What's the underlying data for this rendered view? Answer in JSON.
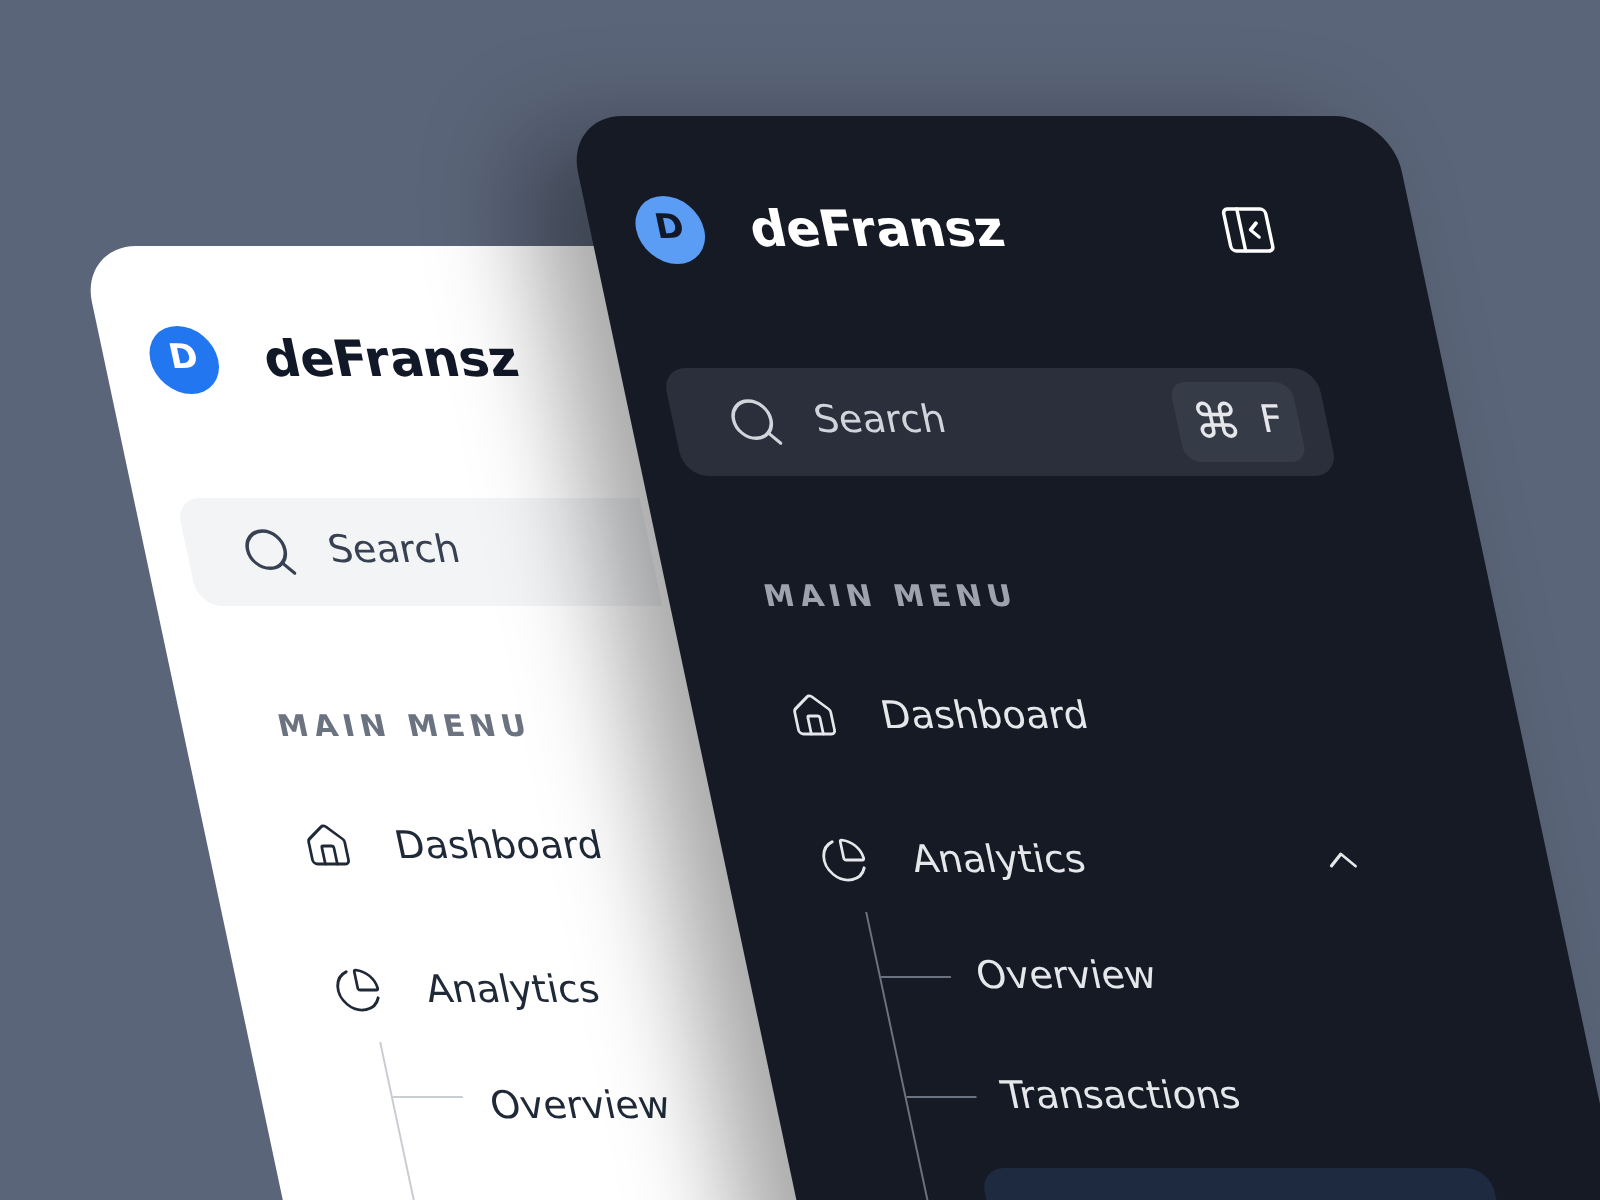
{
  "panels": [
    {
      "kind": "light",
      "brand": {
        "initial": "D",
        "name": "deFransz"
      },
      "search": {
        "placeholder": "Search"
      },
      "section_title": "MAIN MENU",
      "menu": [
        {
          "label": "Dashboard",
          "kind": "home"
        },
        {
          "label": "Analytics",
          "kind": "chart",
          "children": [
            {
              "label": "Overview",
              "selected": false
            }
          ]
        }
      ]
    },
    {
      "kind": "dark",
      "brand": {
        "initial": "D",
        "name": "deFransz"
      },
      "collapse_button": true,
      "search": {
        "placeholder": "Search",
        "shortcut": {
          "modifier": "⌘",
          "key": "F"
        }
      },
      "section_title": "MAIN MENU",
      "menu": [
        {
          "label": "Dashboard",
          "kind": "home"
        },
        {
          "label": "Analytics",
          "kind": "chart",
          "expanded": true,
          "children": [
            {
              "label": "Overview",
              "selected": false
            },
            {
              "label": "Transactions",
              "selected": false
            },
            {
              "selected": true
            }
          ]
        }
      ]
    }
  ]
}
